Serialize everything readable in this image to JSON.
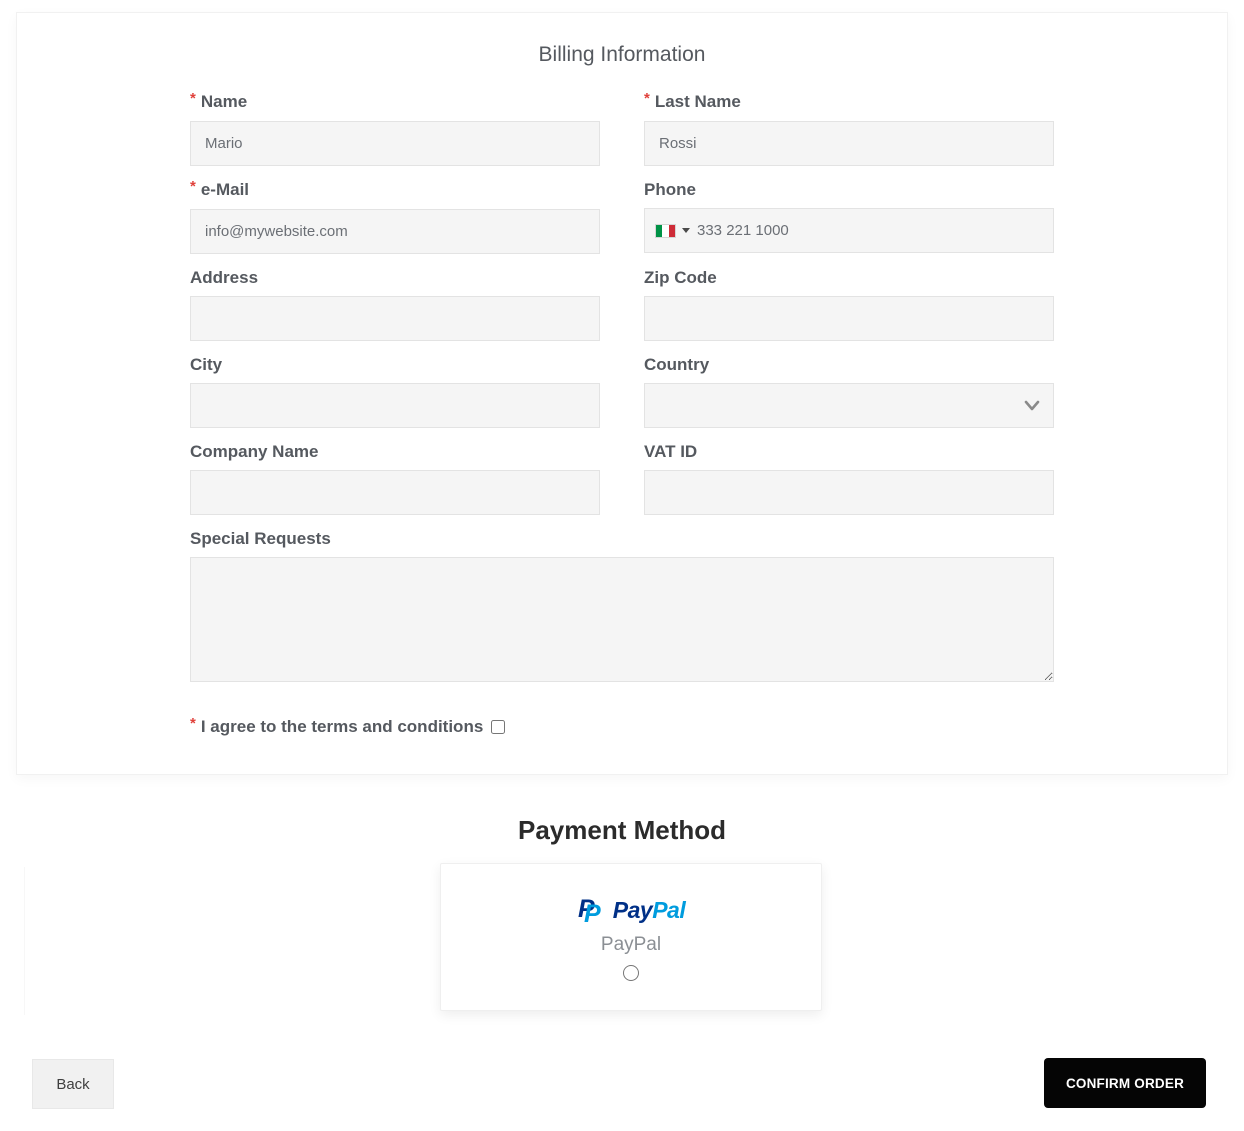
{
  "billing": {
    "title": "Billing Information",
    "required_marker": "*",
    "fields": {
      "name": {
        "label": "Name",
        "required": true,
        "value": "Mario"
      },
      "last_name": {
        "label": "Last Name",
        "required": true,
        "value": "Rossi"
      },
      "email": {
        "label": "e-Mail",
        "required": true,
        "value": "info@mywebsite.com"
      },
      "phone": {
        "label": "Phone",
        "required": false,
        "value": "333 221 1000",
        "flag": "italy-flag"
      },
      "address": {
        "label": "Address",
        "required": false,
        "value": ""
      },
      "zip": {
        "label": "Zip Code",
        "required": false,
        "value": ""
      },
      "city": {
        "label": "City",
        "required": false,
        "value": ""
      },
      "country": {
        "label": "Country",
        "required": false,
        "value": ""
      },
      "company": {
        "label": "Company Name",
        "required": false,
        "value": ""
      },
      "vat": {
        "label": "VAT ID",
        "required": false,
        "value": ""
      },
      "special_requests": {
        "label": "Special Requests",
        "required": false,
        "value": ""
      }
    },
    "terms": {
      "label": "I agree to the terms and conditions",
      "required": true,
      "checked": false
    }
  },
  "payment": {
    "title": "Payment Method",
    "methods": [
      {
        "name": "PayPal",
        "logo": "paypal-logo",
        "wordmark_part1": "Pay",
        "wordmark_part2": "Pal",
        "monogram_letter": "P",
        "selected": false
      }
    ]
  },
  "footer": {
    "back_label": "Back",
    "confirm_label": "CONFIRM ORDER"
  },
  "colors": {
    "paypal_dark_blue": "#003087",
    "paypal_light_blue": "#009cde",
    "required_red": "#e0403a",
    "confirm_button_bg": "#050505",
    "input_bg": "#f5f5f5",
    "label_gray": "#55595f",
    "flag_green": "#009246",
    "flag_red": "#ce2b37"
  }
}
